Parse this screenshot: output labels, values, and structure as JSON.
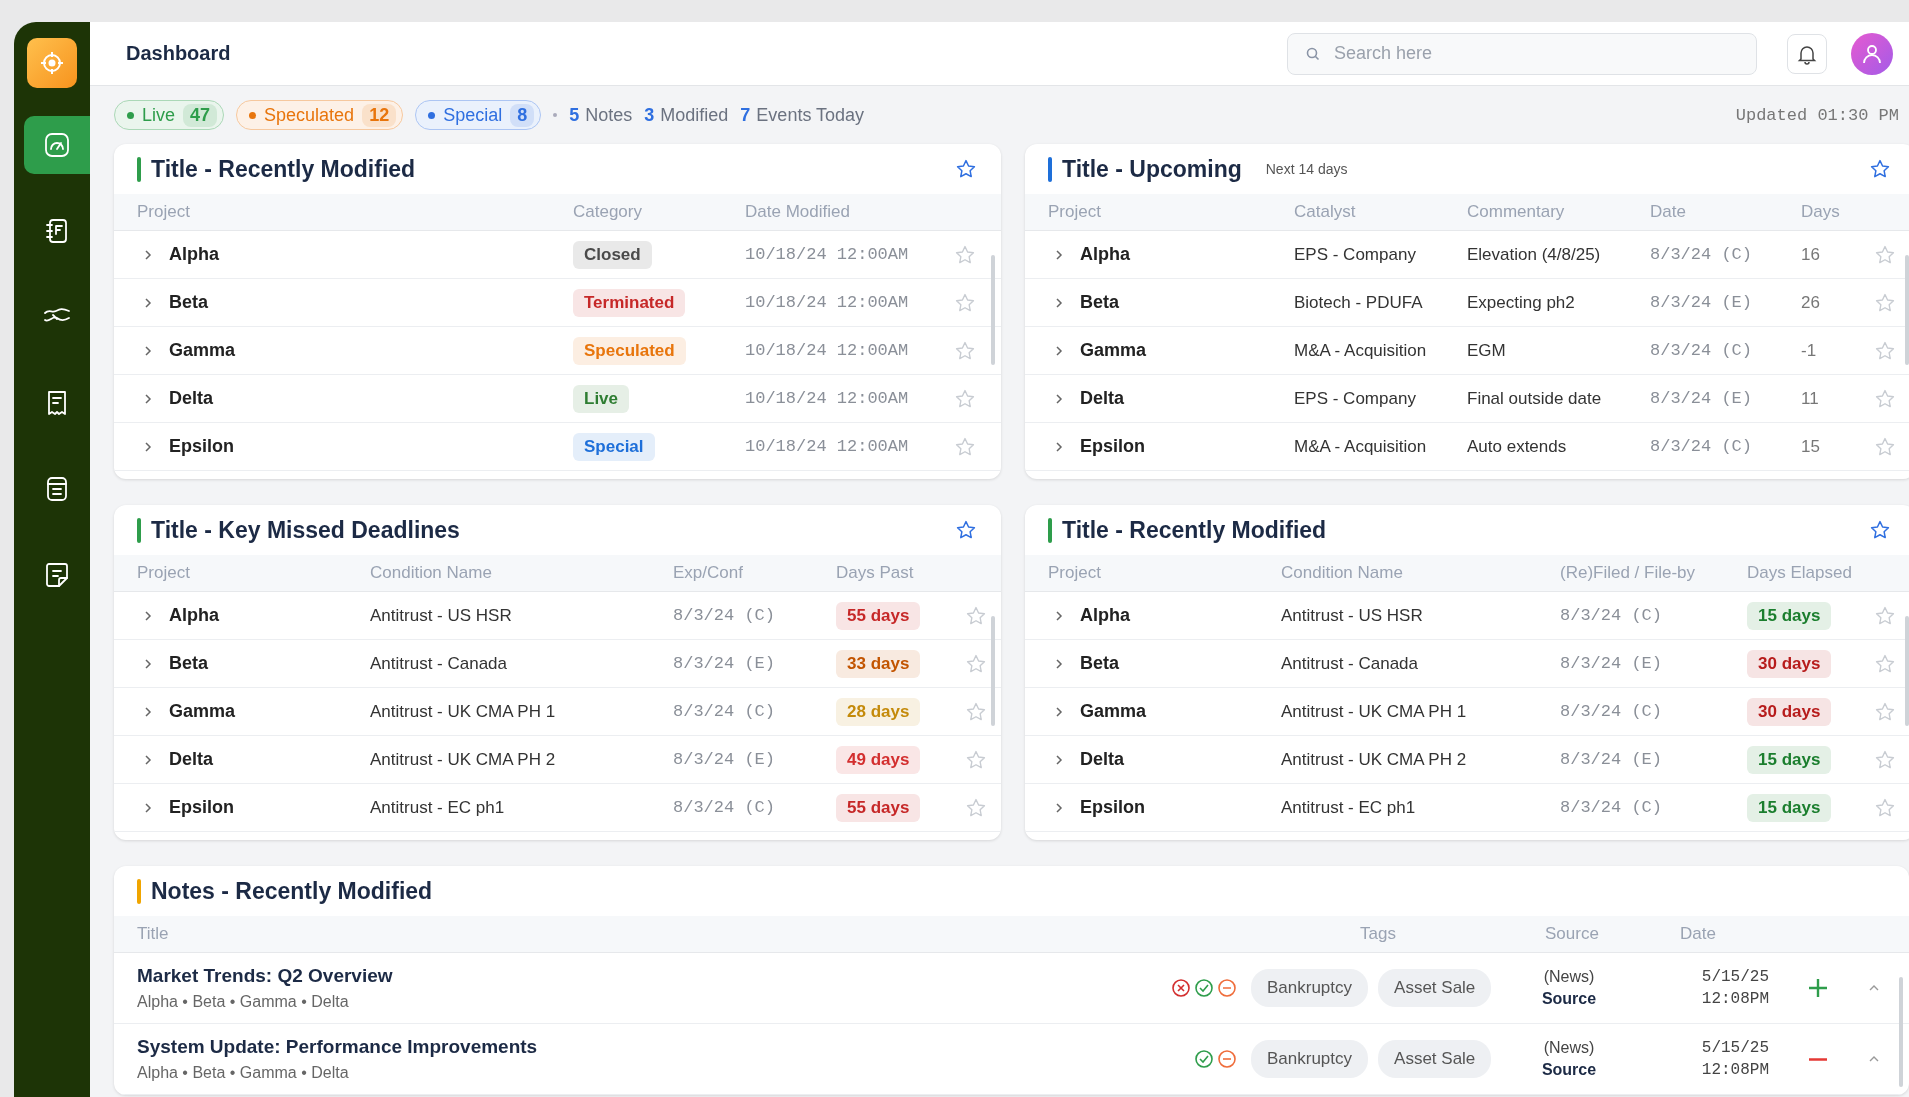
{
  "sidebar": {
    "items": [
      {
        "kind": "gauge",
        "selected": true
      },
      {
        "kind": "notebook",
        "selected": false
      },
      {
        "kind": "handshake",
        "selected": false
      },
      {
        "kind": "receipt",
        "selected": false
      },
      {
        "kind": "stack",
        "selected": false
      },
      {
        "kind": "note",
        "selected": false
      }
    ]
  },
  "header": {
    "title": "Dashboard",
    "search": {
      "placeholder": "Search here"
    }
  },
  "summary": {
    "chips": [
      {
        "label": "Live",
        "count": "47",
        "color": "#2e9d4b"
      },
      {
        "label": "Speculated",
        "count": "12",
        "color": "#e8750c"
      },
      {
        "label": "Special",
        "count": "8",
        "color": "#2f6fe0"
      }
    ],
    "stats": [
      {
        "count": "5",
        "label": "Notes"
      },
      {
        "count": "3",
        "label": "Modified"
      },
      {
        "count": "7",
        "label": "Events Today"
      }
    ],
    "updated": "Updated 01:30 PM"
  },
  "panels": [
    {
      "title": "Title - Recently Modified",
      "color": "#2e9d4b",
      "columns": [
        "Project",
        "Category",
        "Date Modified"
      ],
      "rows": [
        {
          "starred": false,
          "cells": [
            {
              "kind": "project",
              "text": "Alpha"
            },
            {
              "kind": "badge",
              "text": "Closed",
              "color": "#4a4a4a"
            },
            {
              "kind": "mono",
              "text": "10/18/24 12:00AM"
            }
          ]
        },
        {
          "starred": false,
          "cells": [
            {
              "kind": "project",
              "text": "Beta"
            },
            {
              "kind": "badge",
              "text": "Terminated",
              "color": "#c62828"
            },
            {
              "kind": "mono",
              "text": "10/18/24 12:00AM"
            }
          ]
        },
        {
          "starred": false,
          "cells": [
            {
              "kind": "project",
              "text": "Gamma"
            },
            {
              "kind": "badge",
              "text": "Speculated",
              "color": "#e8750c"
            },
            {
              "kind": "mono",
              "text": "10/18/24 12:00AM"
            }
          ]
        },
        {
          "starred": false,
          "cells": [
            {
              "kind": "project",
              "text": "Delta"
            },
            {
              "kind": "badge",
              "text": "Live",
              "color": "#2e7d32"
            },
            {
              "kind": "mono",
              "text": "10/18/24 12:00AM"
            }
          ]
        },
        {
          "starred": false,
          "cells": [
            {
              "kind": "project",
              "text": "Epsilon"
            },
            {
              "kind": "badge",
              "text": "Special",
              "color": "#1e6fd9"
            },
            {
              "kind": "mono",
              "text": "10/18/24 12:00AM"
            }
          ]
        }
      ]
    },
    {
      "title": "Title - Upcoming",
      "subtitle": "Next 14 days",
      "color": "#1e6fd9",
      "columns": [
        "Project",
        "Catalyst",
        "Commentary",
        "Date",
        "Days"
      ],
      "rows": [
        {
          "starred": false,
          "cells": [
            {
              "kind": "project",
              "text": "Alpha"
            },
            {
              "kind": "text",
              "text": "EPS - Company"
            },
            {
              "kind": "text",
              "text": "Elevation (4/8/25)"
            },
            {
              "kind": "mono",
              "text": "8/3/24 (C)"
            },
            {
              "kind": "muted",
              "text": "16"
            }
          ]
        },
        {
          "starred": false,
          "cells": [
            {
              "kind": "project",
              "text": "Beta"
            },
            {
              "kind": "text",
              "text": "Biotech - PDUFA"
            },
            {
              "kind": "text",
              "text": "Expecting ph2"
            },
            {
              "kind": "mono",
              "text": "8/3/24 (E)"
            },
            {
              "kind": "muted",
              "text": "26"
            }
          ]
        },
        {
          "starred": false,
          "cells": [
            {
              "kind": "project",
              "text": "Gamma"
            },
            {
              "kind": "text",
              "text": "M&A - Acquisition"
            },
            {
              "kind": "text",
              "text": "EGM"
            },
            {
              "kind": "mono",
              "text": "8/3/24 (C)"
            },
            {
              "kind": "muted",
              "text": "-1"
            }
          ]
        },
        {
          "starred": false,
          "cells": [
            {
              "kind": "project",
              "text": "Delta"
            },
            {
              "kind": "text",
              "text": "EPS - Company"
            },
            {
              "kind": "text",
              "text": "Final outside date"
            },
            {
              "kind": "mono",
              "text": "8/3/24 (E)"
            },
            {
              "kind": "muted",
              "text": "11"
            }
          ]
        },
        {
          "starred": false,
          "cells": [
            {
              "kind": "project",
              "text": "Epsilon"
            },
            {
              "kind": "text",
              "text": "M&A - Acquisition"
            },
            {
              "kind": "text",
              "text": "Auto extends"
            },
            {
              "kind": "mono",
              "text": "8/3/24 (C)"
            },
            {
              "kind": "muted",
              "text": "15"
            }
          ]
        }
      ]
    },
    {
      "title": "Title - Key Missed Deadlines",
      "color": "#2e9d4b",
      "columns": [
        "Project",
        "Condition Name",
        "Exp/Conf",
        "Days Past"
      ],
      "rows": [
        {
          "starred": false,
          "cells": [
            {
              "kind": "project",
              "text": "Alpha"
            },
            {
              "kind": "text",
              "text": "Antitrust - US HSR"
            },
            {
              "kind": "mono",
              "text": "8/3/24 (C)"
            },
            {
              "kind": "badge",
              "text": "55 days",
              "color": "#c62828"
            }
          ]
        },
        {
          "starred": false,
          "cells": [
            {
              "kind": "project",
              "text": "Beta"
            },
            {
              "kind": "text",
              "text": "Antitrust - Canada"
            },
            {
              "kind": "mono",
              "text": "8/3/24 (E)"
            },
            {
              "kind": "badge",
              "text": "33 days",
              "color": "#c25400"
            }
          ]
        },
        {
          "starred": false,
          "cells": [
            {
              "kind": "project",
              "text": "Gamma"
            },
            {
              "kind": "text",
              "text": "Antitrust - UK CMA PH 1"
            },
            {
              "kind": "mono",
              "text": "8/3/24 (C)"
            },
            {
              "kind": "badge",
              "text": "28 days",
              "color": "#c48a0a"
            }
          ]
        },
        {
          "starred": false,
          "cells": [
            {
              "kind": "project",
              "text": "Delta"
            },
            {
              "kind": "text",
              "text": "Antitrust - UK CMA PH 2"
            },
            {
              "kind": "mono",
              "text": "8/3/24 (E)"
            },
            {
              "kind": "badge",
              "text": "49 days",
              "color": "#d32f2f"
            }
          ]
        },
        {
          "starred": false,
          "cells": [
            {
              "kind": "project",
              "text": "Epsilon"
            },
            {
              "kind": "text",
              "text": "Antitrust - EC ph1"
            },
            {
              "kind": "mono",
              "text": "8/3/24 (C)"
            },
            {
              "kind": "badge",
              "text": "55 days",
              "color": "#c62828"
            }
          ]
        }
      ]
    },
    {
      "title": "Title - Recently Modified",
      "color": "#2e9d4b",
      "columns": [
        "Project",
        "Condition Name",
        "(Re)Filed / File-by",
        "Days Elapsed"
      ],
      "rows": [
        {
          "starred": false,
          "cells": [
            {
              "kind": "project",
              "text": "Alpha"
            },
            {
              "kind": "text",
              "text": "Antitrust - US HSR"
            },
            {
              "kind": "mono",
              "text": "8/3/24 (C)"
            },
            {
              "kind": "badge",
              "text": "15 days",
              "color": "#1b7e2e"
            }
          ]
        },
        {
          "starred": false,
          "cells": [
            {
              "kind": "project",
              "text": "Beta"
            },
            {
              "kind": "text",
              "text": "Antitrust - Canada"
            },
            {
              "kind": "mono",
              "text": "8/3/24 (E)"
            },
            {
              "kind": "badge",
              "text": "30 days",
              "color": "#b71c1c"
            }
          ]
        },
        {
          "starred": false,
          "cells": [
            {
              "kind": "project",
              "text": "Gamma"
            },
            {
              "kind": "text",
              "text": "Antitrust - UK CMA PH 1"
            },
            {
              "kind": "mono",
              "text": "8/3/24 (C)"
            },
            {
              "kind": "badge",
              "text": "30 days",
              "color": "#b71c1c"
            }
          ]
        },
        {
          "starred": false,
          "cells": [
            {
              "kind": "project",
              "text": "Delta"
            },
            {
              "kind": "text",
              "text": "Antitrust - UK CMA PH 2"
            },
            {
              "kind": "mono",
              "text": "8/3/24 (E)"
            },
            {
              "kind": "badge",
              "text": "15 days",
              "color": "#1b7e2e"
            }
          ]
        },
        {
          "starred": false,
          "cells": [
            {
              "kind": "project",
              "text": "Epsilon"
            },
            {
              "kind": "text",
              "text": "Antitrust - EC ph1"
            },
            {
              "kind": "mono",
              "text": "8/3/24 (C)"
            },
            {
              "kind": "badge",
              "text": "15 days",
              "color": "#1b7e2e"
            }
          ]
        }
      ]
    }
  ],
  "notes": {
    "title": "Notes - Recently Modified",
    "color": "#f0a500",
    "columns": [
      "Title",
      "Tags",
      "Source",
      "Date"
    ],
    "rows": [
      {
        "title": "Market Trends: Q2 Overview",
        "projects": "Alpha • Beta • Gamma • Delta",
        "statuses": [
          {
            "kind": "error"
          },
          {
            "kind": "ok"
          },
          {
            "kind": "pending"
          }
        ],
        "tags": [
          "Bankruptcy",
          "Asset Sale"
        ],
        "source": "(News)",
        "source_label": "Source",
        "date": "5/15/25",
        "time": "12:08PM",
        "action": {
          "kind": "add"
        }
      },
      {
        "title": "System Update: Performance Improvements",
        "projects": "Alpha • Beta • Gamma • Delta",
        "statuses": [
          {
            "kind": "ok"
          },
          {
            "kind": "pending"
          }
        ],
        "tags": [
          "Bankruptcy",
          "Asset Sale"
        ],
        "source": "(News)",
        "source_label": "Source",
        "date": "5/15/25",
        "time": "12:08PM",
        "action": {
          "kind": "remove"
        }
      }
    ]
  }
}
